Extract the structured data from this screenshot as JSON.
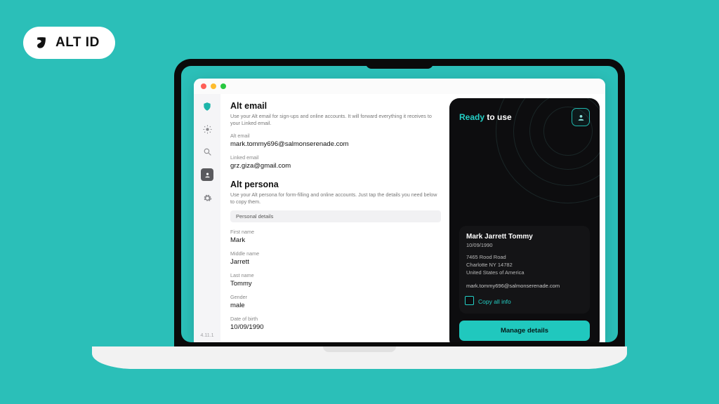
{
  "badge": {
    "text": "ALT ID"
  },
  "window": {
    "version": "4.11.1"
  },
  "sidebar": {
    "items": [
      {
        "name": "shield-icon"
      },
      {
        "name": "sun-icon"
      },
      {
        "name": "search-icon"
      },
      {
        "name": "alt-id-icon"
      },
      {
        "name": "gear-icon"
      }
    ]
  },
  "main": {
    "alt_email": {
      "title": "Alt email",
      "desc": "Use your Alt email for sign-ups and online accounts. It will forward everything it receives to your Linked email.",
      "alt_label": "Alt email",
      "alt_value": "mark.tommy696@salmonserenade.com",
      "linked_label": "Linked email",
      "linked_value": "grz.giza@gmail.com"
    },
    "alt_persona": {
      "title": "Alt persona",
      "desc": "Use your Alt persona for form-filling and online accounts. Just tap the details you need below to copy them.",
      "tab_label": "Personal details",
      "fields": {
        "first_name_label": "First name",
        "first_name_value": "Mark",
        "middle_name_label": "Middle name",
        "middle_name_value": "Jarrett",
        "last_name_label": "Last name",
        "last_name_value": "Tommy",
        "gender_label": "Gender",
        "gender_value": "male",
        "dob_label": "Date of birth",
        "dob_value": "10/09/1990"
      }
    }
  },
  "card": {
    "title_accent": "Ready",
    "title_rest": " to use",
    "name": "Mark Jarrett Tommy",
    "dob": "10/09/1990",
    "addr1": "7465 Rood Road",
    "addr2": "Charlotte NY 14782",
    "addr3": "United States of America",
    "email": "mark.tommy696@salmonserenade.com",
    "copy_label": "Copy all info",
    "manage_label": "Manage details"
  }
}
